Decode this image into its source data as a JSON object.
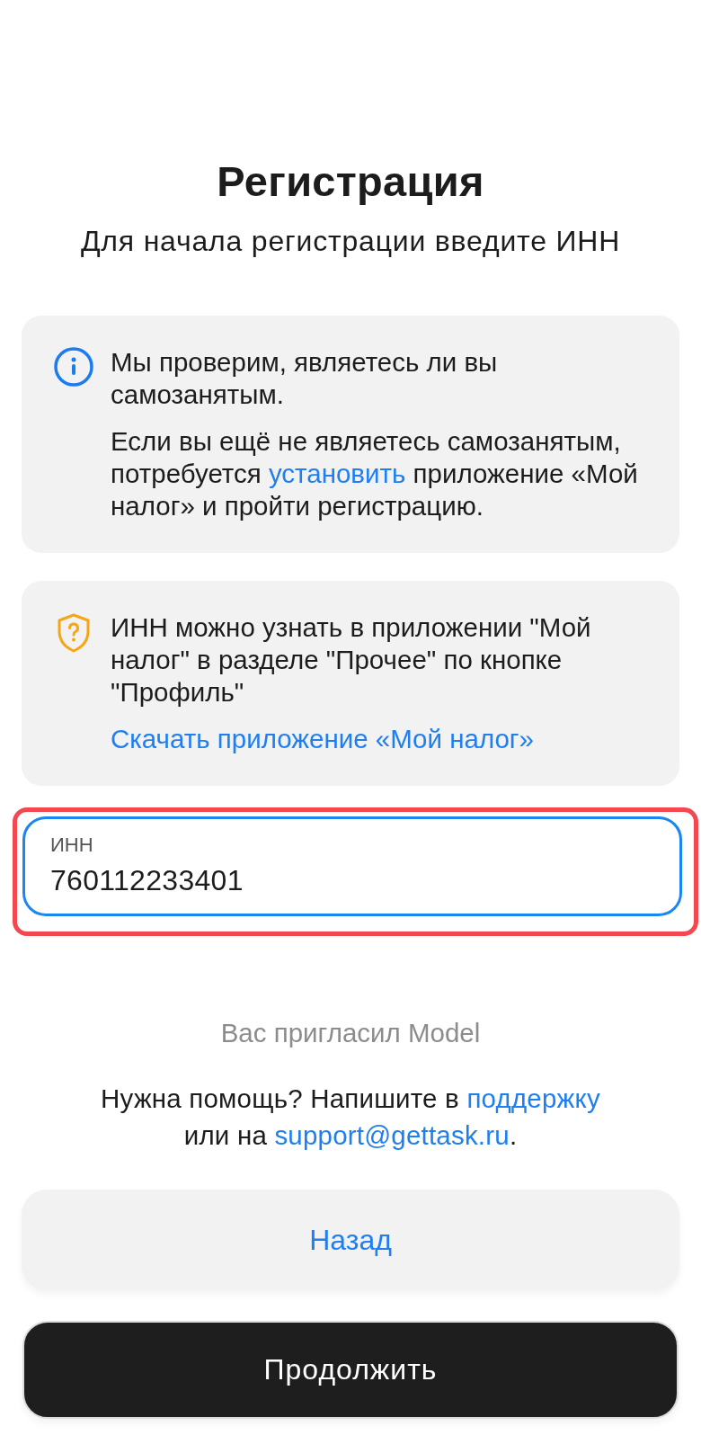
{
  "header": {
    "title": "Регистрация",
    "subtitle": "Для начала регистрации введите ИНН"
  },
  "notices": [
    {
      "kind": "info",
      "paragraphs": [
        [
          {
            "kind": "text",
            "text": "Мы проверим, являетесь ли вы самозанятым."
          }
        ],
        [
          {
            "kind": "text",
            "text": "Если вы ещё не являетесь самозанятым, потребуется "
          },
          {
            "kind": "link",
            "text": "установить"
          },
          {
            "kind": "text",
            "text": " приложение «Мой налог» и пройти регистрацию."
          }
        ]
      ]
    },
    {
      "kind": "hint",
      "paragraphs": [
        [
          {
            "kind": "text",
            "text": "ИНН можно узнать в приложении \"Мой налог\" в разделе \"Прочее\" по кнопке \"Профиль\""
          }
        ],
        [
          {
            "kind": "link",
            "text": "Скачать приложение «Мой налог»"
          }
        ]
      ]
    }
  ],
  "inn_field": {
    "label": "ИНН",
    "value": "760112233401",
    "focused": true,
    "highlighted": true
  },
  "referral": "Вас пригласил Model",
  "help": {
    "lines": [
      [
        {
          "kind": "text",
          "text": "Нужна помощь? Напишите в "
        },
        {
          "kind": "link",
          "text": "поддержку"
        }
      ],
      [
        {
          "kind": "text",
          "text": "или на "
        },
        {
          "kind": "email",
          "text": "support@gettask.ru"
        },
        {
          "kind": "text",
          "text": "."
        }
      ]
    ]
  },
  "buttons": [
    {
      "kind": "secondary",
      "label": "Назад"
    },
    {
      "kind": "primary",
      "label": "Продолжить"
    }
  ]
}
